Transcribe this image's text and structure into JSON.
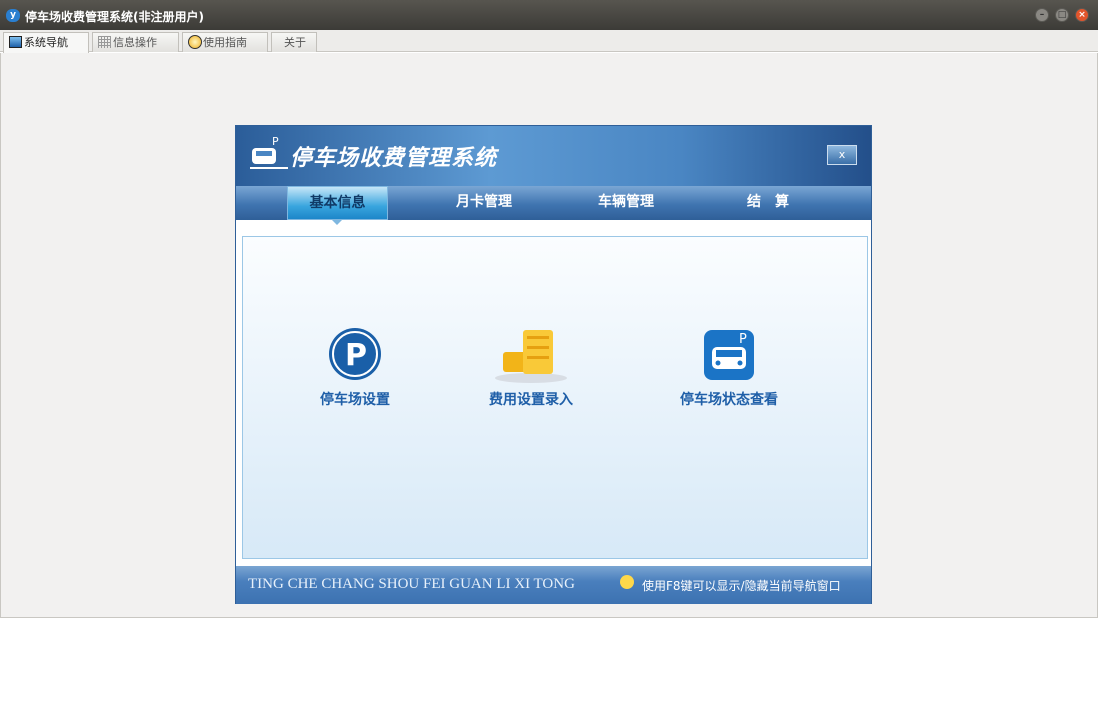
{
  "window": {
    "title": "停车场收费管理系统(非注册用户)"
  },
  "tabs": [
    {
      "label": "系统导航",
      "active": true
    },
    {
      "label": "信息操作"
    },
    {
      "label": "使用指南"
    },
    {
      "label": "关于"
    }
  ],
  "panel": {
    "title": "停车场收费管理系统",
    "close_label": "x",
    "nav": [
      {
        "label": "基本信息",
        "active": true
      },
      {
        "label": "月卡管理"
      },
      {
        "label": "车辆管理"
      },
      {
        "label": "结　算"
      }
    ],
    "functions": [
      {
        "label": "停车场设置",
        "icon": "parking-icon"
      },
      {
        "label": "费用设置录入",
        "icon": "coins-icon"
      },
      {
        "label": "停车场状态查看",
        "icon": "car-status-icon"
      }
    ],
    "footer": {
      "pinyin": "TING CHE CHANG SHOU FEI  GUAN LI XI TONG",
      "hint": "使用F8键可以显示/隐藏当前导航窗口"
    }
  },
  "colors": {
    "accent": "#1f5fa8",
    "header": "#4a86c3"
  }
}
